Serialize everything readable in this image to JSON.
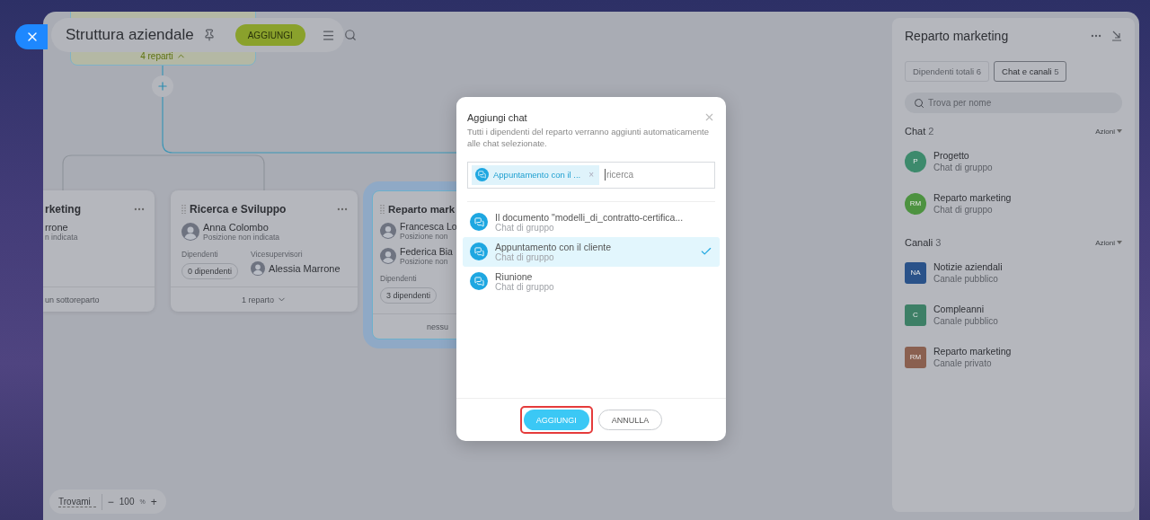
{
  "header": {
    "title": "Struttura aziendale",
    "add_button": "AGGIUNGI"
  },
  "top_card": {
    "count": "4 reparti",
    "expanded": true
  },
  "cards": [
    {
      "title": "rketing",
      "selected": false,
      "people": [
        {
          "name": "rrone",
          "position": "n indicata"
        }
      ],
      "footer": "un sottoreparto"
    },
    {
      "title": "Ricerca e Sviluppo",
      "selected": false,
      "people": [
        {
          "name": "Anna Colombo",
          "position": "Posizione non indicata"
        }
      ],
      "employees_label": "Dipendenti",
      "employees": "0 dipendenti",
      "deputies_label": "Vicesupervisori",
      "deputy": "Alessia Marrone",
      "footer": "1 reparto",
      "expanded": false
    },
    {
      "title": "Reparto mark",
      "selected": true,
      "people": [
        {
          "name": "Francesca Lo",
          "position": "Posizione non"
        },
        {
          "name": "Federica Bia",
          "position": "Posizione non"
        }
      ],
      "employees_label": "Dipendenti",
      "employees": "3 dipendenti",
      "footer": "nessu"
    }
  ],
  "zoom": {
    "find": "Trovami",
    "minus": "−",
    "value": "100",
    "unit": "%",
    "plus": "+"
  },
  "panel": {
    "title": "Reparto marketing",
    "tabs": [
      {
        "label": "Dipendenti totali",
        "count": "6",
        "selected": false
      },
      {
        "label": "Chat e canali",
        "count": "5",
        "selected": true
      }
    ],
    "search": {
      "placeholder": "Trova per nome"
    },
    "sections": [
      {
        "title": "Chat",
        "count": "2",
        "action": "Azioni",
        "items": [
          {
            "kind": "round",
            "initials": "P",
            "name": "Progetto",
            "type": "Chat di gruppo",
            "color": "#3d8a6c"
          },
          {
            "kind": "round",
            "initials": "RM",
            "name": "Reparto marketing",
            "type": "Chat di gruppo",
            "color": "#4d9240"
          }
        ]
      },
      {
        "title": "Canali",
        "count": "3",
        "action": "Azioni",
        "items": [
          {
            "kind": "square",
            "initials": "NA",
            "name": "Notizie aziendali",
            "type": "Canale pubblico",
            "color": "#2a5289"
          },
          {
            "kind": "square",
            "initials": "C",
            "name": "Compleanni",
            "type": "Canale pubblico",
            "color": "#3d7f66"
          },
          {
            "kind": "square",
            "initials": "RM",
            "name": "Reparto marketing",
            "type": "Canale privato",
            "color": "#8a6050"
          }
        ]
      }
    ]
  },
  "dialog": {
    "title": "Aggiungi chat",
    "description": "Tutti i dipendenti del reparto verranno aggiunti automaticamente alle chat selezionate.",
    "chips": [
      {
        "label": "Appuntamento con il ...",
        "remove": "×"
      }
    ],
    "search": {
      "placeholder": "ricerca"
    },
    "items": [
      {
        "name": "Il documento \"modelli_di_contratto-certifica...",
        "type": "Chat di gruppo",
        "selected": false
      },
      {
        "name": "Appuntamento con il cliente",
        "type": "Chat di gruppo",
        "selected": true
      },
      {
        "name": "Riunione",
        "type": "Chat di gruppo",
        "selected": false
      }
    ],
    "buttons": [
      {
        "kind": "primary",
        "label": "AGGIUNGI",
        "highlighted": true
      },
      {
        "kind": "secondary",
        "label": "ANNULLA",
        "highlighted": false
      }
    ]
  }
}
